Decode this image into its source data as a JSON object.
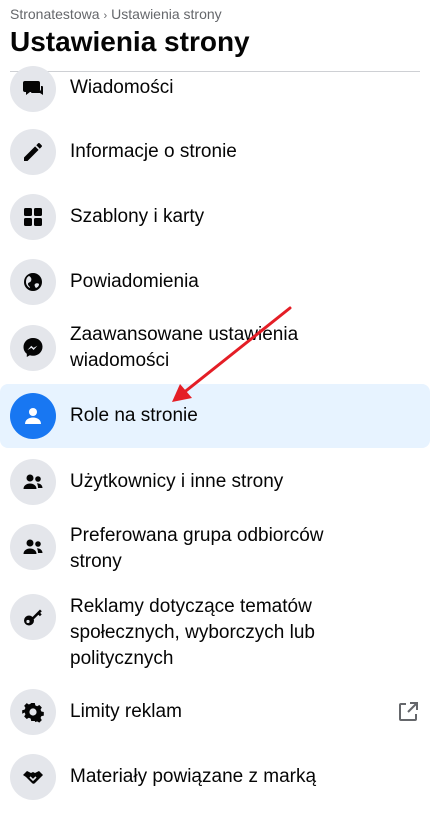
{
  "header": {
    "breadcrumb": [
      "Stronatestowa",
      "Ustawienia strony"
    ],
    "title": "Ustawienia strony"
  },
  "menu": {
    "items": [
      {
        "label": "Wiadomości",
        "icon": "chat-bubble-icon"
      },
      {
        "label": "Informacje o stronie",
        "icon": "pencil-icon"
      },
      {
        "label": "Szablony i karty",
        "icon": "grid-icon"
      },
      {
        "label": "Powiadomienia",
        "icon": "globe-icon"
      },
      {
        "label": "Zaawansowane ustawienia wiadomości",
        "icon": "messenger-icon"
      },
      {
        "label": "Role na stronie",
        "icon": "person-icon",
        "active": true
      },
      {
        "label": "Użytkownicy i inne strony",
        "icon": "people-icon"
      },
      {
        "label": "Preferowana grupa odbiorców strony",
        "icon": "people-icon"
      },
      {
        "label": "Reklamy dotyczące tematów społecznych, wyborczych lub politycznych",
        "icon": "key-icon"
      },
      {
        "label": "Limity reklam",
        "icon": "gear-icon",
        "external": true
      },
      {
        "label": "Materiały powiązane z marką",
        "icon": "handshake-icon"
      }
    ]
  },
  "colors": {
    "accent": "#1877f2",
    "active_bg": "#e7f3ff",
    "icon_bg": "#e4e6eb",
    "annotation_arrow": "#e41e26"
  }
}
